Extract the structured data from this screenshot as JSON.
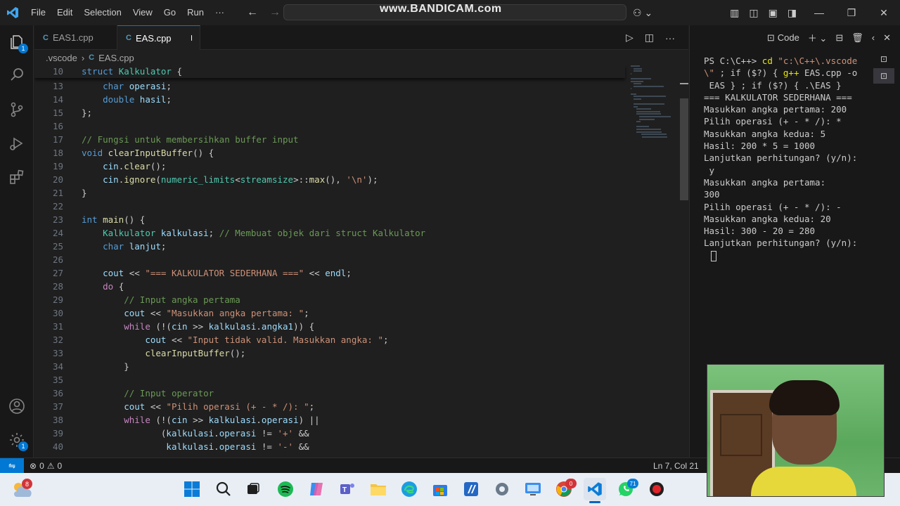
{
  "titlebar": {
    "menu": [
      "File",
      "Edit",
      "Selection",
      "View",
      "Go",
      "Run",
      "···"
    ],
    "watermark": "www.BANDICAM.com"
  },
  "tabs": [
    {
      "label": "EAS1.cpp",
      "icon": "C"
    },
    {
      "label": "EAS.cpp",
      "icon": "C",
      "modified": true
    }
  ],
  "breadcrumb": {
    "folder": ".vscode",
    "file": "EAS.cpp"
  },
  "activity": {
    "explorer_badge": "1",
    "settings_badge": "1"
  },
  "code_lines": [
    {
      "n": "10",
      "html": "<span class='kw'>struct</span> <span class='ty'>Kalkulator</span> {"
    },
    {
      "n": "13",
      "html": "    <span class='kw'>char</span> <span class='var'>operasi</span>;"
    },
    {
      "n": "14",
      "html": "    <span class='kw'>double</span> <span class='var'>hasil</span>;"
    },
    {
      "n": "15",
      "html": "};"
    },
    {
      "n": "16",
      "html": ""
    },
    {
      "n": "17",
      "html": "<span class='cm'>// Fungsi untuk membersihkan buffer input</span>"
    },
    {
      "n": "18",
      "html": "<span class='kw'>void</span> <span class='fn'>clearInputBuffer</span>() {"
    },
    {
      "n": "19",
      "html": "    <span class='var'>cin</span>.<span class='fn'>clear</span>();"
    },
    {
      "n": "20",
      "html": "    <span class='var'>cin</span>.<span class='fn'>ignore</span>(<span class='ty'>numeric_limits</span>&lt;<span class='ty'>streamsize</span>&gt;::<span class='fn'>max</span>(), <span class='str'>'\\n'</span>);"
    },
    {
      "n": "21",
      "html": "}"
    },
    {
      "n": "22",
      "html": ""
    },
    {
      "n": "23",
      "html": "<span class='kw'>int</span> <span class='fn'>main</span>() {"
    },
    {
      "n": "24",
      "html": "    <span class='ty'>Kalkulator</span> <span class='var'>kalkulasi</span>; <span class='cm'>// Membuat objek dari struct Kalkulator</span>"
    },
    {
      "n": "25",
      "html": "    <span class='kw'>char</span> <span class='var'>lanjut</span>;"
    },
    {
      "n": "26",
      "html": ""
    },
    {
      "n": "27",
      "html": "    <span class='var'>cout</span> &lt;&lt; <span class='str'>\"=== KALKULATOR SEDERHANA ===\"</span> &lt;&lt; <span class='var'>endl</span>;"
    },
    {
      "n": "28",
      "html": "    <span class='ctl'>do</span> {"
    },
    {
      "n": "29",
      "html": "        <span class='cm'>// Input angka pertama</span>"
    },
    {
      "n": "30",
      "html": "        <span class='var'>cout</span> &lt;&lt; <span class='str'>\"Masukkan angka pertama: \"</span>;"
    },
    {
      "n": "31",
      "html": "        <span class='ctl'>while</span> (!(<span class='var'>cin</span> &gt;&gt; <span class='var'>kalkulasi</span>.<span class='var'>angka1</span>)) {"
    },
    {
      "n": "32",
      "html": "            <span class='var'>cout</span> &lt;&lt; <span class='str'>\"Input tidak valid. Masukkan angka: \"</span>;"
    },
    {
      "n": "33",
      "html": "            <span class='fn'>clearInputBuffer</span>();"
    },
    {
      "n": "34",
      "html": "        }"
    },
    {
      "n": "35",
      "html": ""
    },
    {
      "n": "36",
      "html": "        <span class='cm'>// Input operator</span>"
    },
    {
      "n": "37",
      "html": "        <span class='var'>cout</span> &lt;&lt; <span class='str'>\"Pilih operasi (+ - * /): \"</span>;"
    },
    {
      "n": "38",
      "html": "        <span class='ctl'>while</span> (!(<span class='var'>cin</span> &gt;&gt; <span class='var'>kalkulasi</span>.<span class='var'>operasi</span>) ||"
    },
    {
      "n": "39",
      "html": "               (<span class='var'>kalkulasi</span>.<span class='var'>operasi</span> != <span class='str'>'+'</span> &amp;&amp;"
    },
    {
      "n": "40",
      "html": "                <span class='var'>kalkulasi</span>.<span class='var'>operasi</span> != <span class='str'>'-'</span> &amp;&amp;"
    }
  ],
  "panel": {
    "terminal_label": "Code"
  },
  "terminal_lines": [
    "PS C:\\C++> <span class='t-y'>cd</span> <span class='t-s'>\"c:\\C++\\.vscode</span>",
    "<span class='t-s'>\\\"</span> ; if ($?) { <span class='t-y'>g++</span> EAS.cpp -o",
    " EAS } ; if ($?) { .\\EAS }",
    "=== KALKULATOR SEDERHANA ===",
    "Masukkan angka pertama: 200",
    "Pilih operasi (+ - * /): *",
    "Masukkan angka kedua: 5",
    "Hasil: 200 * 5 = 1000",
    "Lanjutkan perhitungan? (y/n):",
    " y",
    "Masukkan angka pertama:",
    "300",
    "Pilih operasi (+ - * /): -",
    "Masukkan angka kedua: 20",
    "Hasil: 300 - 20 = 280",
    "Lanjutkan perhitungan? (y/n):"
  ],
  "status": {
    "errors": "0",
    "warnings": "0",
    "position": "Ln 7, Col 21"
  },
  "taskbar": {
    "weather_badge": "8",
    "chrome_badge": "0",
    "whatsapp_badge": "71"
  }
}
